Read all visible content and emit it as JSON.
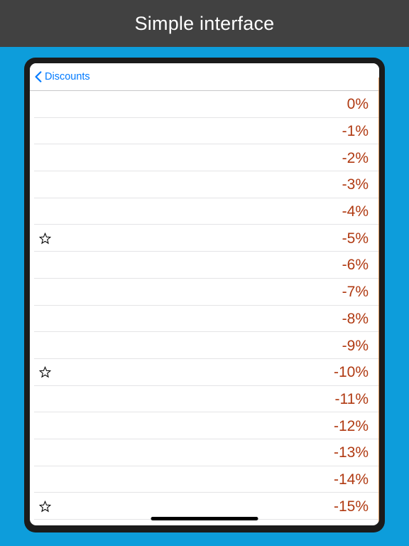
{
  "window": {
    "title": "Simple interface",
    "background_color": "#0d9ddb",
    "titlebar_color": "#414141"
  },
  "navbar": {
    "back_label": "Discounts",
    "back_icon": "chevron-left-icon",
    "accent_color": "#007aff"
  },
  "list": {
    "value_color": "#b03a12",
    "star_icon": "star-outline-icon",
    "rows": [
      {
        "value": "0%",
        "starred": false
      },
      {
        "value": "-1%",
        "starred": false
      },
      {
        "value": "-2%",
        "starred": false
      },
      {
        "value": "-3%",
        "starred": false
      },
      {
        "value": "-4%",
        "starred": false
      },
      {
        "value": "-5%",
        "starred": true
      },
      {
        "value": "-6%",
        "starred": false
      },
      {
        "value": "-7%",
        "starred": false
      },
      {
        "value": "-8%",
        "starred": false
      },
      {
        "value": "-9%",
        "starred": false
      },
      {
        "value": "-10%",
        "starred": true
      },
      {
        "value": "-11%",
        "starred": false
      },
      {
        "value": "-12%",
        "starred": false
      },
      {
        "value": "-13%",
        "starred": false
      },
      {
        "value": "-14%",
        "starred": false
      },
      {
        "value": "-15%",
        "starred": true
      }
    ]
  }
}
